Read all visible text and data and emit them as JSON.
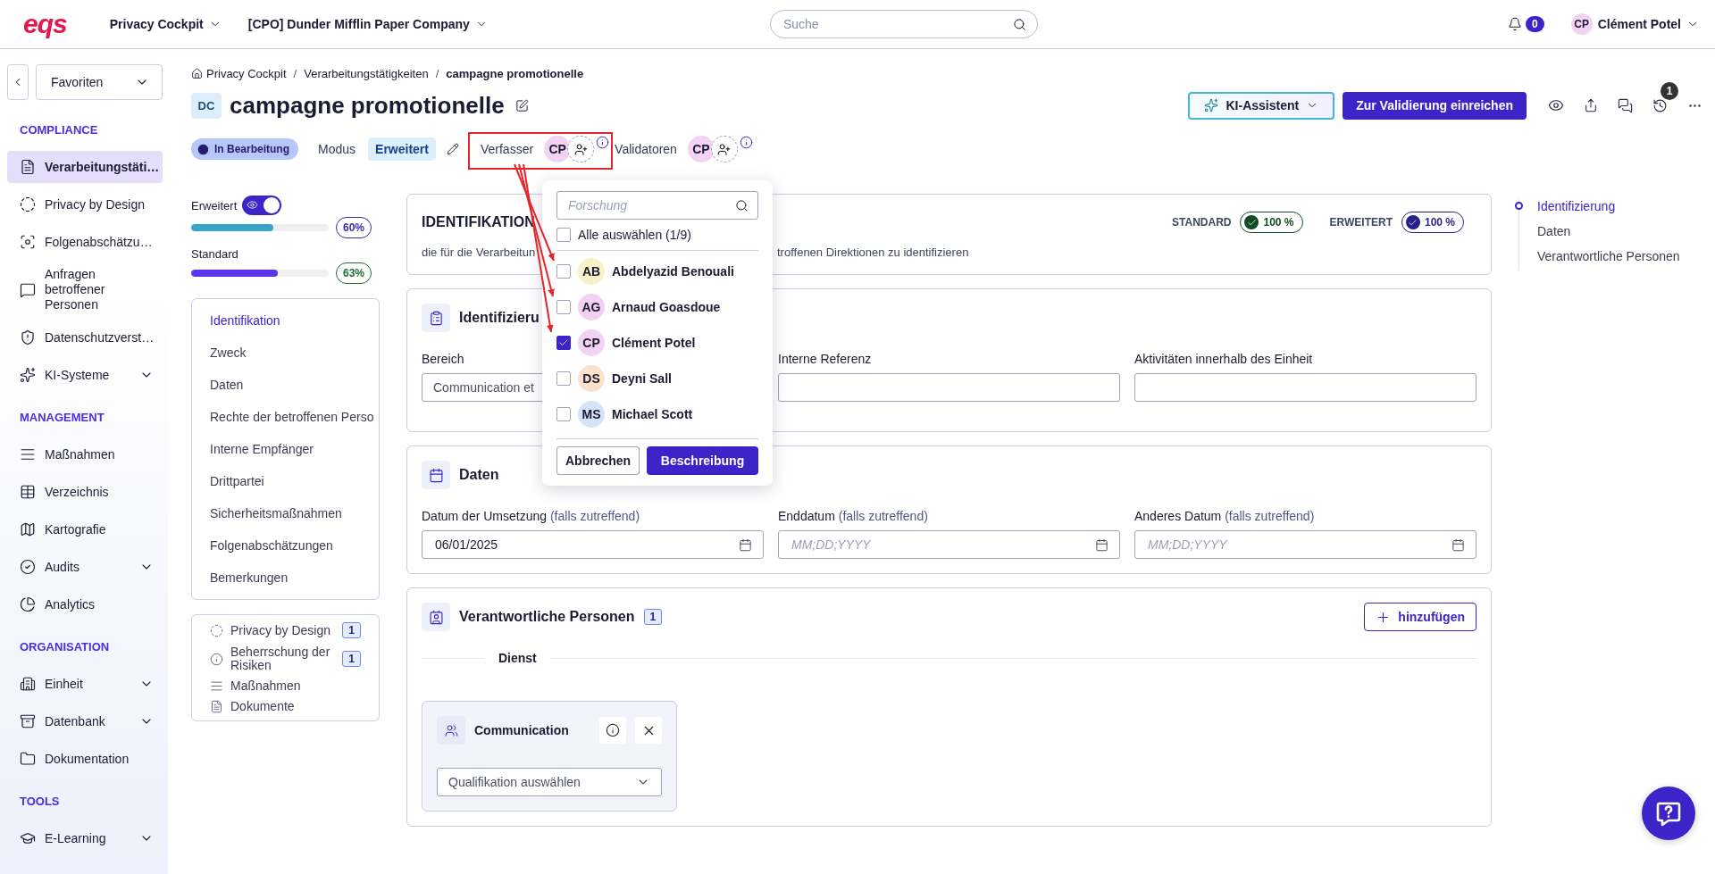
{
  "topbar": {
    "logo": "eqs",
    "menus": [
      "Privacy Cockpit",
      "[CPO] Dunder Mifflin Paper Company"
    ],
    "search": {
      "placeholder": "Suche"
    },
    "notifications": "0",
    "user": {
      "initials": "CP",
      "name": "Clément Potel"
    }
  },
  "sidebar": {
    "favorites": "Favoriten",
    "sections": [
      {
        "title": "COMPLIANCE",
        "items": [
          {
            "label": "Verarbeitungstäti…",
            "selected": true,
            "expandable": false
          },
          {
            "label": "Privacy by Design",
            "selected": false,
            "expandable": false
          },
          {
            "label": "Folgenabschätzu…",
            "selected": false,
            "expandable": false
          },
          {
            "label": "Anfragen betroffener Personen",
            "selected": false,
            "expandable": false
          },
          {
            "label": "Datenschutzverst…",
            "selected": false,
            "expandable": false
          },
          {
            "label": "KI-Systeme",
            "selected": false,
            "expandable": true
          }
        ]
      },
      {
        "title": "MANAGEMENT",
        "items": [
          {
            "label": "Maßnahmen",
            "selected": false,
            "expandable": false
          },
          {
            "label": "Verzeichnis",
            "selected": false,
            "expandable": false
          },
          {
            "label": "Kartografie",
            "selected": false,
            "expandable": false
          },
          {
            "label": "Audits",
            "selected": false,
            "expandable": true
          },
          {
            "label": "Analytics",
            "selected": false,
            "expandable": false
          }
        ]
      },
      {
        "title": "ORGANISATION",
        "items": [
          {
            "label": "Einheit",
            "selected": false,
            "expandable": true
          },
          {
            "label": "Datenbank",
            "selected": false,
            "expandable": true
          },
          {
            "label": "Dokumentation",
            "selected": false,
            "expandable": false
          }
        ]
      },
      {
        "title": "TOOLS",
        "items": [
          {
            "label": "E-Learning",
            "selected": false,
            "expandable": true
          }
        ]
      }
    ]
  },
  "breadcrumb": {
    "separator": "/",
    "items": [
      "Privacy Cockpit",
      "Verarbeitungstätigkeiten",
      "campagne promotionelle"
    ]
  },
  "title": {
    "badge": "DC",
    "text": "campagne promotionelle"
  },
  "actions": {
    "assistant": "KI-Assistent",
    "submit": "Zur Validierung einreichen",
    "history_count": "1"
  },
  "status": {
    "state": "In Bearbeitung",
    "mode_label": "Modus",
    "mode": "Erweitert",
    "author_label": "Verfasser",
    "authors": [
      "CP"
    ],
    "validators_label": "Validatoren",
    "validators": [
      "CP"
    ]
  },
  "progress": {
    "toggle": {
      "label": "Erweitert",
      "on": true
    },
    "bars": [
      {
        "level": 0.6,
        "reading": "60%"
      },
      {
        "label": "Standard",
        "level": 0.63,
        "reading": "63%"
      }
    ]
  },
  "section_nav": [
    {
      "label": "Identifikation",
      "selected": true
    },
    {
      "label": "Zweck",
      "selected": false
    },
    {
      "label": "Daten",
      "selected": false
    },
    {
      "label": "Rechte der betroffenen Perso",
      "selected": false
    },
    {
      "label": "Interne Empfänger",
      "selected": false
    },
    {
      "label": "Drittpartei",
      "selected": false
    },
    {
      "label": "Sicherheitsmaßnahmen",
      "selected": false
    },
    {
      "label": "Folgenabschätzungen",
      "selected": false
    },
    {
      "label": "Bemerkungen",
      "selected": false
    }
  ],
  "links": [
    {
      "label": "Privacy by Design",
      "count": "1"
    },
    {
      "label": "Beherrschung der Risiken",
      "count": "1"
    },
    {
      "label": "Maßnahmen"
    },
    {
      "label": "Dokumente"
    }
  ],
  "overview": {
    "title": "IDENTIFIKATION",
    "scores": [
      {
        "label": "STANDARD",
        "value": "100 %"
      },
      {
        "label": "ERWEITERT",
        "value": "100 %"
      }
    ],
    "description_parts": [
      "die für die Verarbeitun",
      "troffenen Direktionen zu identifizieren"
    ]
  },
  "identification": {
    "title": "Identifizieru",
    "fields": [
      {
        "label": "Bereich",
        "value": "Communication et"
      },
      {
        "label": "Interne Referenz"
      },
      {
        "label": "Aktivitäten innerhalb des Einheit"
      }
    ]
  },
  "dates": {
    "title": "Daten",
    "fields": [
      {
        "label": "Datum der Umsetzung",
        "hint": "(falls zutreffend)",
        "value": "06/01/2025"
      },
      {
        "label": "Enddatum",
        "hint": "(falls zutreffend)",
        "placeholder": "MM;DD;YYYY"
      },
      {
        "label": "Anderes Datum",
        "hint": "(falls zutreffend)",
        "placeholder": "MM;DD;YYYY"
      }
    ]
  },
  "responsible": {
    "title": "Verantwortliche Personen",
    "count": "1",
    "add": "hinzufügen",
    "group": "Dienst",
    "entries": [
      {
        "name": "Communication",
        "select": {
          "placeholder": "Qualifikation auswählen"
        }
      }
    ]
  },
  "toc": [
    {
      "label": "Identifizierung",
      "selected": true
    },
    {
      "label": "Daten",
      "selected": false
    },
    {
      "label": "Verantwortliche Personen",
      "selected": false
    }
  ],
  "picker": {
    "search": {
      "placeholder": "Forschung"
    },
    "select_all": {
      "label": "Alle auswählen (1/9)",
      "checked": false
    },
    "people": [
      {
        "initials": "AB",
        "name": "Abdelyazid Benouali",
        "color": "#f8f1c8",
        "checked": false
      },
      {
        "initials": "AG",
        "name": "Arnaud Goasdoue",
        "color": "#f5d0f0",
        "checked": false
      },
      {
        "initials": "CP",
        "name": "Clément Potel",
        "color": "#f3d3f3",
        "checked": true
      },
      {
        "initials": "DS",
        "name": "Deyni Sall",
        "color": "#fbe0cc",
        "checked": false
      },
      {
        "initials": "MS",
        "name": "Michael Scott",
        "color": "#d5e3f8",
        "checked": false
      }
    ],
    "cancel": "Abbrechen",
    "confirm": "Beschreibung"
  }
}
